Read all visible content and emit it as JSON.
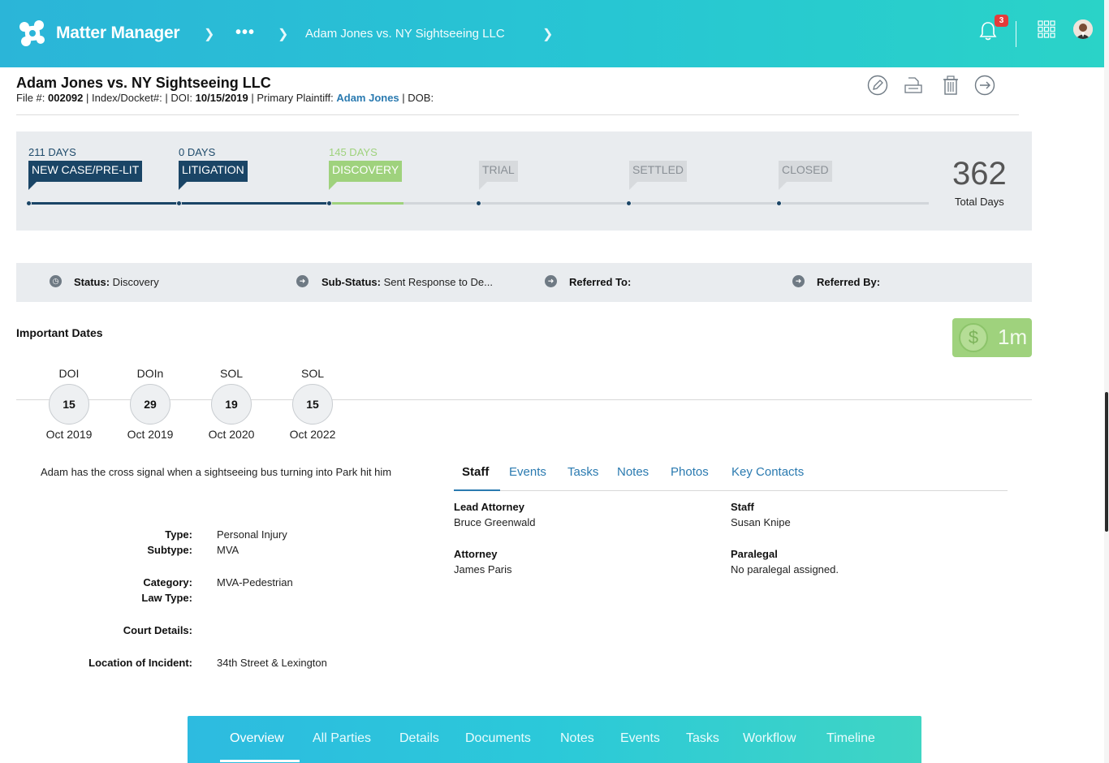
{
  "topbar": {
    "app_name": "Matter Manager",
    "breadcrumb_more": "•••",
    "breadcrumb_case": "Adam Jones vs. NY Sightseeing LLC",
    "notification_count": "3"
  },
  "header": {
    "title": "Adam Jones vs. NY Sightseeing LLC",
    "file_label": "File #: ",
    "file_number": "002092",
    "index_label": " | Index/Docket#:  | DOI: ",
    "doi": "10/15/2019",
    "plaintiff_label": " | Primary Plaintiff: ",
    "plaintiff": "Adam Jones",
    "dob_label": " | DOB:"
  },
  "stages": [
    {
      "days": "211 DAYS",
      "label": "NEW CASE/PRE-LIT"
    },
    {
      "days": "0 DAYS",
      "label": "LITIGATION"
    },
    {
      "days": "145 DAYS",
      "label": "DISCOVERY"
    },
    {
      "days": "",
      "label": "TRIAL"
    },
    {
      "days": "",
      "label": "SETTLED"
    },
    {
      "days": "",
      "label": "CLOSED"
    }
  ],
  "totals": {
    "value": "362",
    "label": "Total Days"
  },
  "status_bar": {
    "status_label": "Status:",
    "status_value": " Discovery",
    "substatus_label": "Sub-Status:",
    "substatus_value": " Sent Response to De...",
    "referred_to_label": "Referred To:",
    "referred_by_label": "Referred By:"
  },
  "important_dates": {
    "title": "Important Dates",
    "items": [
      {
        "type": "DOI",
        "day": "15",
        "month": "Oct 2019"
      },
      {
        "type": "DOIn",
        "day": "29",
        "month": "Oct 2019"
      },
      {
        "type": "SOL",
        "day": "19",
        "month": "Oct 2020"
      },
      {
        "type": "SOL",
        "day": "15",
        "month": "Oct 2022"
      }
    ]
  },
  "money": {
    "symbol": "$",
    "value": "1m"
  },
  "description": "Adam has the cross signal when a sightseeing bus turning into Park hit him",
  "details": {
    "type_label": "Type:",
    "type_value": "Personal Injury",
    "subtype_label": "Subtype:",
    "subtype_value": "MVA",
    "category_label": "Category:",
    "category_value": "MVA-Pedestrian",
    "lawtype_label": "Law Type:",
    "court_label": "Court Details:",
    "location_label": "Location of Incident:",
    "location_value": "34th Street & Lexington"
  },
  "right_tabs": [
    "Staff",
    "Events",
    "Tasks",
    "Notes",
    "Photos",
    "Key Contacts"
  ],
  "staff": {
    "lead_attorney_label": "Lead Attorney",
    "lead_attorney": "Bruce Greenwald",
    "staff_label": "Staff",
    "staff": "Susan Knipe",
    "attorney_label": "Attorney",
    "attorney": "James Paris",
    "paralegal_label": "Paralegal",
    "paralegal": "No paralegal assigned."
  },
  "bottom_nav": [
    "Overview",
    "All Parties",
    "Details",
    "Documents",
    "Notes",
    "Events",
    "Tasks",
    "Workflow",
    "Timeline"
  ],
  "colors": {
    "brand_gradient_start": "#2bb5d8",
    "brand_gradient_end": "#2ad3c8",
    "stage_done": "#1a4566",
    "stage_current": "#9fd27d",
    "link": "#2a7ab0",
    "badge_red": "#e43b3b"
  }
}
